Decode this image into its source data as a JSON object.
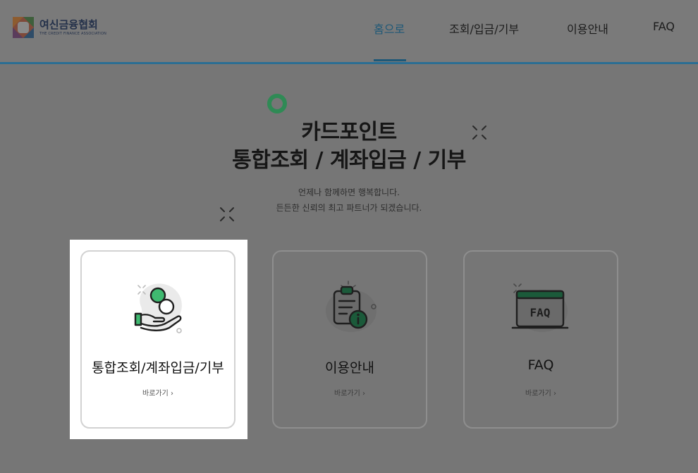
{
  "header": {
    "logo_korean": "여신금융협회",
    "logo_english": "THE CREDIT FINANCE ASSOCIATION",
    "nav": [
      {
        "label": "홈으로",
        "active": true
      },
      {
        "label": "조회/입금/기부",
        "active": false
      },
      {
        "label": "이용안내",
        "active": false
      },
      {
        "label": "FAQ",
        "active": false
      }
    ]
  },
  "hero": {
    "title_line1": "카드포인트",
    "title_line2": "통합조회 / 계좌입금 / 기부",
    "subtitle_line1": "언제나 함께하면 행복합니다.",
    "subtitle_line2": "든든한 신뢰의 최고 파트너가 되겠습니다."
  },
  "cards": [
    {
      "title": "통합조회/계좌입금/기부",
      "link": "바로가기 ›",
      "icon": "hand-coin-icon"
    },
    {
      "title": "이용안내",
      "link": "바로가기 ›",
      "icon": "clipboard-info-icon"
    },
    {
      "title": "FAQ",
      "link": "바로가기 ›",
      "icon": "faq-monitor-icon"
    }
  ],
  "colors": {
    "accent_green": "#2f8a55",
    "nav_active": "#1e5877",
    "overlay_bg": "#767676"
  }
}
